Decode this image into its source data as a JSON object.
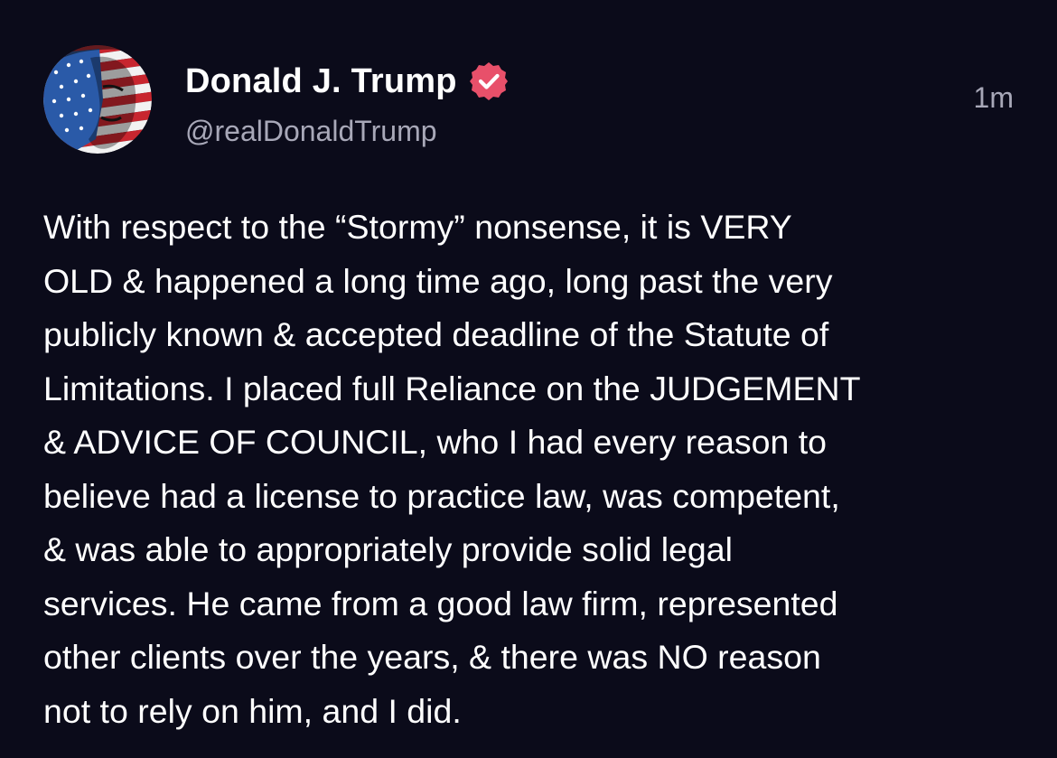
{
  "post": {
    "author": {
      "display_name": "Donald J. Trump",
      "handle": "@realDonaldTrump",
      "verified": true,
      "verified_icon": "verified-badge-icon",
      "verified_color": "#e8506a",
      "avatar_icon": "profile-avatar"
    },
    "timestamp": "1m",
    "body_lines": [
      "With respect to the “Stormy” nonsense, it is VERY",
      "OLD & happened a long time ago, long past the very",
      "publicly known & accepted deadline of the Statute of",
      "Limitations. I placed full Reliance on the JUDGEMENT",
      "& ADVICE OF COUNCIL, who I had every reason to",
      "believe had a license to practice law, was competent,",
      "& was able to appropriately provide solid legal",
      "services. He came from a good law firm, represented",
      "other clients over the years, & there was NO reason",
      "not to rely on him, and I did."
    ]
  },
  "theme": {
    "background": "#0b0b1a",
    "text_primary": "#ffffff",
    "text_secondary": "#a8a8b8"
  }
}
